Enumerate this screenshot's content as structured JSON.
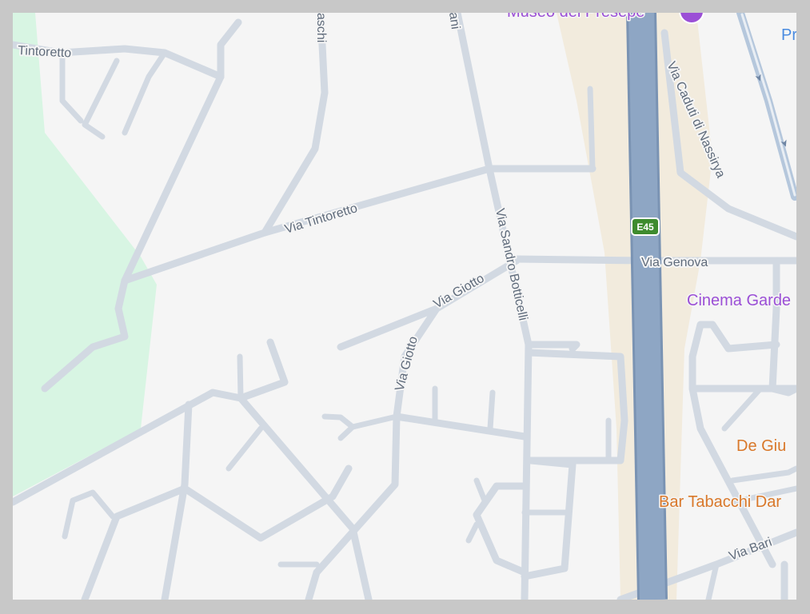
{
  "colors": {
    "map_background": "#f5f5f5",
    "park": "#d8f5e3",
    "motorway_corridor": "#f2ebdd",
    "motorway": "#8ea6c4",
    "local_road": "#d2d9e2",
    "street_label": "#5f6b7b",
    "poi_purple": "#9b4fd6",
    "poi_orange": "#d9782a",
    "poi_blue": "#4a8be0",
    "route_shield": "#3e8b2e"
  },
  "streets": {
    "tintoretto_west": "Tintoretto",
    "tintoretto": "Via Tintoretto",
    "dei_franceschi_partial": "aschi",
    "raffaello_partial": "ani",
    "sandro_botticelli": "Via Sandro Botticelli",
    "giotto_upper": "Via Giotto",
    "giotto_lower": "Via Giotto",
    "genova": "Via Genova",
    "caduti_nassirya": "Via Caduti di Nassirya",
    "bari": "Via Bari"
  },
  "route_shield": {
    "label": "E45",
    "icon": "highway-shield-icon"
  },
  "pois": {
    "museo": {
      "label": "Museo del Presepe",
      "icon": "museum-pin-icon",
      "color": "#9b4fd6"
    },
    "cinema": {
      "label": "Cinema Garde",
      "color": "#9b4fd6"
    },
    "de_giu": {
      "label": "De Giu",
      "color": "#d9782a"
    },
    "bar_tabacchi": {
      "label": "Bar Tabacchi Dar",
      "color": "#d9782a"
    },
    "top_right_partial": {
      "label": "Pr",
      "color": "#4a8be0"
    }
  }
}
